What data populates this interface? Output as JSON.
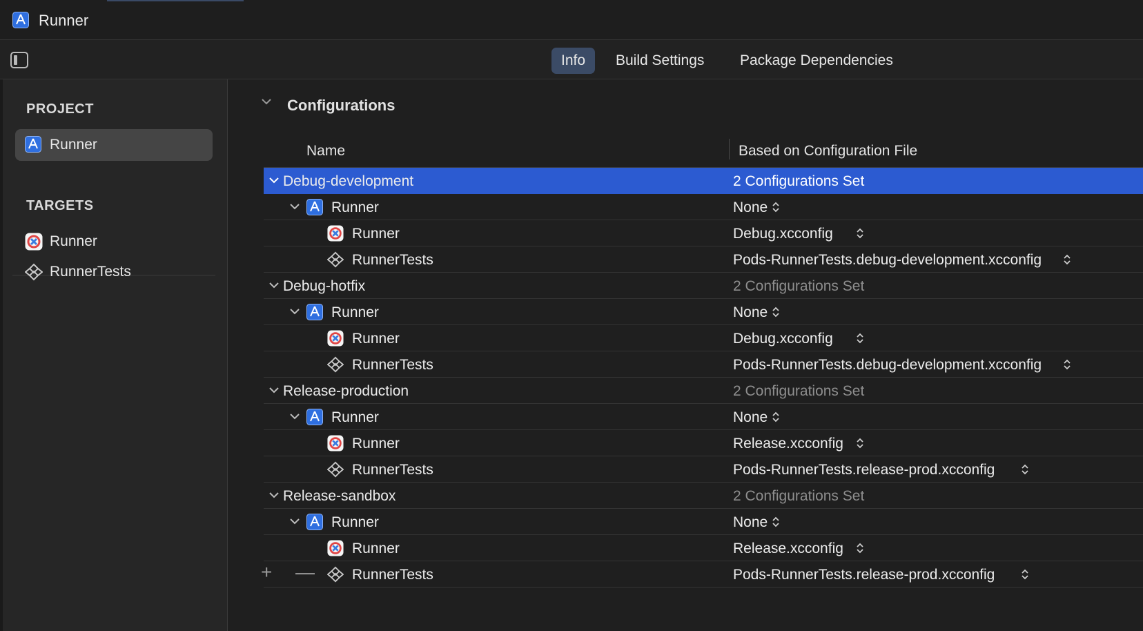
{
  "window": {
    "title": "Runner"
  },
  "tabs": [
    {
      "label": "Info",
      "active": true
    },
    {
      "label": "Build Settings",
      "active": false
    },
    {
      "label": "Package Dependencies",
      "active": false
    }
  ],
  "sidebar": {
    "project_header": "PROJECT",
    "project_items": [
      {
        "label": "Runner",
        "icon": "xcode-project-icon",
        "selected": true
      }
    ],
    "targets_header": "TARGETS",
    "target_items": [
      {
        "label": "Runner",
        "icon": "flutter-app-icon"
      },
      {
        "label": "RunnerTests",
        "icon": "test-bundle-icon"
      }
    ]
  },
  "configurations": {
    "section_title": "Configurations",
    "columns": {
      "name": "Name",
      "file": "Based on Configuration File"
    },
    "groups": [
      {
        "name": "Debug-development",
        "summary": "2 Configurations Set",
        "selected": true,
        "project": {
          "name": "Runner",
          "value": "None"
        },
        "targets": [
          {
            "name": "Runner",
            "value": "Debug.xcconfig"
          },
          {
            "name": "RunnerTests",
            "value": "Pods-RunnerTests.debug-development.xcconfig"
          }
        ]
      },
      {
        "name": "Debug-hotfix",
        "summary": "2 Configurations Set",
        "selected": false,
        "project": {
          "name": "Runner",
          "value": "None"
        },
        "targets": [
          {
            "name": "Runner",
            "value": "Debug.xcconfig"
          },
          {
            "name": "RunnerTests",
            "value": "Pods-RunnerTests.debug-development.xcconfig"
          }
        ]
      },
      {
        "name": "Release-production",
        "summary": "2 Configurations Set",
        "selected": false,
        "project": {
          "name": "Runner",
          "value": "None"
        },
        "targets": [
          {
            "name": "Runner",
            "value": "Release.xcconfig"
          },
          {
            "name": "RunnerTests",
            "value": "Pods-RunnerTests.release-prod.xcconfig"
          }
        ]
      },
      {
        "name": "Release-sandbox",
        "summary": "2 Configurations Set",
        "selected": false,
        "project": {
          "name": "Runner",
          "value": "None"
        },
        "targets": [
          {
            "name": "Runner",
            "value": "Release.xcconfig"
          },
          {
            "name": "RunnerTests",
            "value": "Pods-RunnerTests.release-prod.xcconfig"
          }
        ]
      }
    ],
    "add_button": "+",
    "remove_button": "—"
  },
  "colors": {
    "selection": "#2c5bd1",
    "active_tab": "#3b4b66",
    "background": "#1f1f1f",
    "sidebar": "#262626"
  }
}
